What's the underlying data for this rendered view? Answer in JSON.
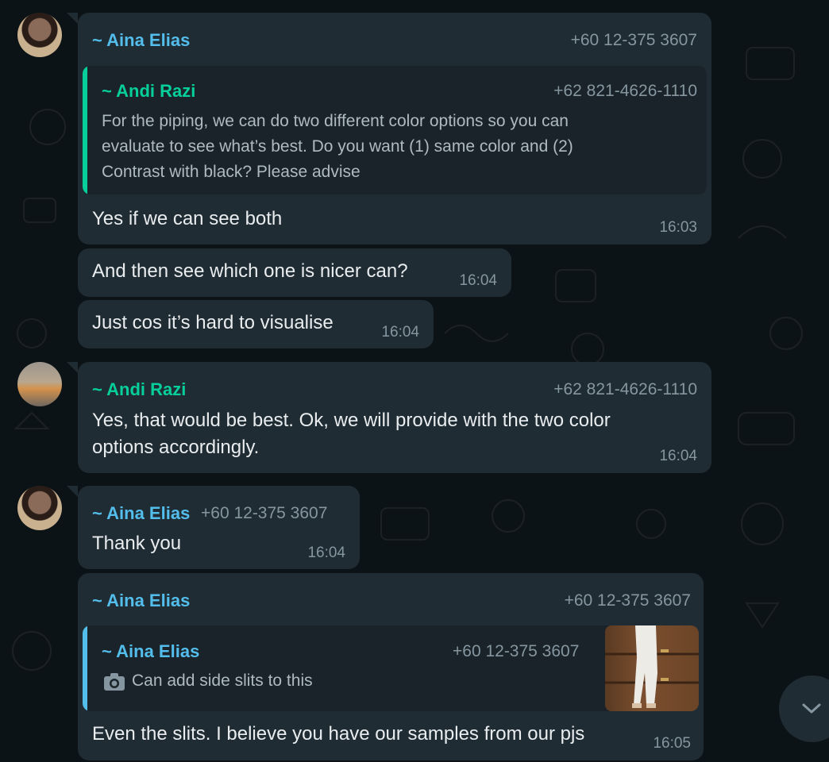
{
  "messages": [
    {
      "sender": "~ Aina Elias",
      "phone": "+60 12-375 3607",
      "quoted": {
        "sender": "~ Andi Razi",
        "phone": "+62 821-4626-1110",
        "lines": [
          "For the piping, we can do two different color options so you can",
          "evaluate to see what’s best. Do you want (1) same color and (2)",
          "Contrast with black? Please advise"
        ]
      },
      "text": "Yes if we can see both",
      "time": "16:03"
    },
    {
      "text": "And then see which one is nicer can?",
      "time": "16:04"
    },
    {
      "text": "Just cos it’s hard to visualise",
      "time": "16:04"
    },
    {
      "sender": "~ Andi Razi",
      "phone": "+62 821-4626-1110",
      "lines": [
        "Yes, that would be best. Ok, we will provide with the two color",
        "options accordingly."
      ],
      "time": "16:04"
    },
    {
      "sender": "~ Aina Elias",
      "phone": "+60 12-375 3607",
      "text": "Thank you",
      "time": "16:04"
    },
    {
      "sender": "~ Aina Elias",
      "phone": "+60 12-375 3607",
      "quoted": {
        "sender": "~ Aina Elias",
        "phone": "+60 12-375 3607",
        "text": "Can add side slits to this",
        "icon": "camera-icon"
      },
      "text": "Even the slits. I believe you have our samples from our pjs",
      "time": "16:05"
    }
  ],
  "colors": {
    "background": "#0c1317",
    "bubble": "#202c33",
    "quote_bg": "#1a2329",
    "name_blue": "#53bdeb",
    "name_green": "#06cf9c",
    "meta_grey": "#8696a0"
  },
  "scroll_button": {
    "icon": "chevron-down-icon"
  }
}
